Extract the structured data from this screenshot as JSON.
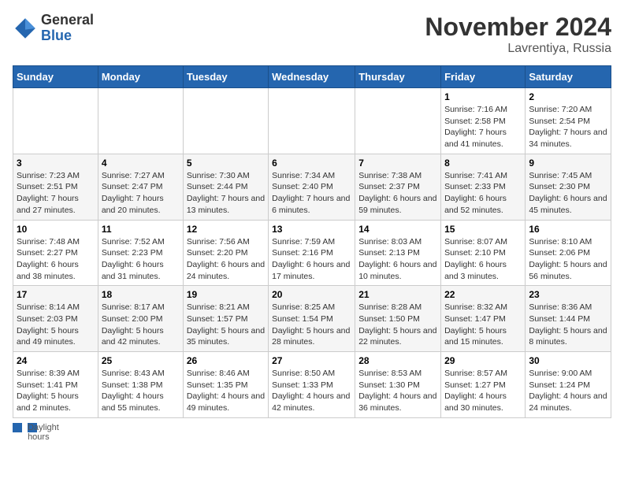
{
  "header": {
    "logo_general": "General",
    "logo_blue": "Blue",
    "month_title": "November 2024",
    "location": "Lavrentiya, Russia"
  },
  "days_of_week": [
    "Sunday",
    "Monday",
    "Tuesday",
    "Wednesday",
    "Thursday",
    "Friday",
    "Saturday"
  ],
  "weeks": [
    [
      {
        "num": "",
        "sunrise": "",
        "sunset": "",
        "daylight": ""
      },
      {
        "num": "",
        "sunrise": "",
        "sunset": "",
        "daylight": ""
      },
      {
        "num": "",
        "sunrise": "",
        "sunset": "",
        "daylight": ""
      },
      {
        "num": "",
        "sunrise": "",
        "sunset": "",
        "daylight": ""
      },
      {
        "num": "",
        "sunrise": "",
        "sunset": "",
        "daylight": ""
      },
      {
        "num": "1",
        "sunrise": "Sunrise: 7:16 AM",
        "sunset": "Sunset: 2:58 PM",
        "daylight": "Daylight: 7 hours and 41 minutes."
      },
      {
        "num": "2",
        "sunrise": "Sunrise: 7:20 AM",
        "sunset": "Sunset: 2:54 PM",
        "daylight": "Daylight: 7 hours and 34 minutes."
      }
    ],
    [
      {
        "num": "3",
        "sunrise": "Sunrise: 7:23 AM",
        "sunset": "Sunset: 2:51 PM",
        "daylight": "Daylight: 7 hours and 27 minutes."
      },
      {
        "num": "4",
        "sunrise": "Sunrise: 7:27 AM",
        "sunset": "Sunset: 2:47 PM",
        "daylight": "Daylight: 7 hours and 20 minutes."
      },
      {
        "num": "5",
        "sunrise": "Sunrise: 7:30 AM",
        "sunset": "Sunset: 2:44 PM",
        "daylight": "Daylight: 7 hours and 13 minutes."
      },
      {
        "num": "6",
        "sunrise": "Sunrise: 7:34 AM",
        "sunset": "Sunset: 2:40 PM",
        "daylight": "Daylight: 7 hours and 6 minutes."
      },
      {
        "num": "7",
        "sunrise": "Sunrise: 7:38 AM",
        "sunset": "Sunset: 2:37 PM",
        "daylight": "Daylight: 6 hours and 59 minutes."
      },
      {
        "num": "8",
        "sunrise": "Sunrise: 7:41 AM",
        "sunset": "Sunset: 2:33 PM",
        "daylight": "Daylight: 6 hours and 52 minutes."
      },
      {
        "num": "9",
        "sunrise": "Sunrise: 7:45 AM",
        "sunset": "Sunset: 2:30 PM",
        "daylight": "Daylight: 6 hours and 45 minutes."
      }
    ],
    [
      {
        "num": "10",
        "sunrise": "Sunrise: 7:48 AM",
        "sunset": "Sunset: 2:27 PM",
        "daylight": "Daylight: 6 hours and 38 minutes."
      },
      {
        "num": "11",
        "sunrise": "Sunrise: 7:52 AM",
        "sunset": "Sunset: 2:23 PM",
        "daylight": "Daylight: 6 hours and 31 minutes."
      },
      {
        "num": "12",
        "sunrise": "Sunrise: 7:56 AM",
        "sunset": "Sunset: 2:20 PM",
        "daylight": "Daylight: 6 hours and 24 minutes."
      },
      {
        "num": "13",
        "sunrise": "Sunrise: 7:59 AM",
        "sunset": "Sunset: 2:16 PM",
        "daylight": "Daylight: 6 hours and 17 minutes."
      },
      {
        "num": "14",
        "sunrise": "Sunrise: 8:03 AM",
        "sunset": "Sunset: 2:13 PM",
        "daylight": "Daylight: 6 hours and 10 minutes."
      },
      {
        "num": "15",
        "sunrise": "Sunrise: 8:07 AM",
        "sunset": "Sunset: 2:10 PM",
        "daylight": "Daylight: 6 hours and 3 minutes."
      },
      {
        "num": "16",
        "sunrise": "Sunrise: 8:10 AM",
        "sunset": "Sunset: 2:06 PM",
        "daylight": "Daylight: 5 hours and 56 minutes."
      }
    ],
    [
      {
        "num": "17",
        "sunrise": "Sunrise: 8:14 AM",
        "sunset": "Sunset: 2:03 PM",
        "daylight": "Daylight: 5 hours and 49 minutes."
      },
      {
        "num": "18",
        "sunrise": "Sunrise: 8:17 AM",
        "sunset": "Sunset: 2:00 PM",
        "daylight": "Daylight: 5 hours and 42 minutes."
      },
      {
        "num": "19",
        "sunrise": "Sunrise: 8:21 AM",
        "sunset": "Sunset: 1:57 PM",
        "daylight": "Daylight: 5 hours and 35 minutes."
      },
      {
        "num": "20",
        "sunrise": "Sunrise: 8:25 AM",
        "sunset": "Sunset: 1:54 PM",
        "daylight": "Daylight: 5 hours and 28 minutes."
      },
      {
        "num": "21",
        "sunrise": "Sunrise: 8:28 AM",
        "sunset": "Sunset: 1:50 PM",
        "daylight": "Daylight: 5 hours and 22 minutes."
      },
      {
        "num": "22",
        "sunrise": "Sunrise: 8:32 AM",
        "sunset": "Sunset: 1:47 PM",
        "daylight": "Daylight: 5 hours and 15 minutes."
      },
      {
        "num": "23",
        "sunrise": "Sunrise: 8:36 AM",
        "sunset": "Sunset: 1:44 PM",
        "daylight": "Daylight: 5 hours and 8 minutes."
      }
    ],
    [
      {
        "num": "24",
        "sunrise": "Sunrise: 8:39 AM",
        "sunset": "Sunset: 1:41 PM",
        "daylight": "Daylight: 5 hours and 2 minutes."
      },
      {
        "num": "25",
        "sunrise": "Sunrise: 8:43 AM",
        "sunset": "Sunset: 1:38 PM",
        "daylight": "Daylight: 4 hours and 55 minutes."
      },
      {
        "num": "26",
        "sunrise": "Sunrise: 8:46 AM",
        "sunset": "Sunset: 1:35 PM",
        "daylight": "Daylight: 4 hours and 49 minutes."
      },
      {
        "num": "27",
        "sunrise": "Sunrise: 8:50 AM",
        "sunset": "Sunset: 1:33 PM",
        "daylight": "Daylight: 4 hours and 42 minutes."
      },
      {
        "num": "28",
        "sunrise": "Sunrise: 8:53 AM",
        "sunset": "Sunset: 1:30 PM",
        "daylight": "Daylight: 4 hours and 36 minutes."
      },
      {
        "num": "29",
        "sunrise": "Sunrise: 8:57 AM",
        "sunset": "Sunset: 1:27 PM",
        "daylight": "Daylight: 4 hours and 30 minutes."
      },
      {
        "num": "30",
        "sunrise": "Sunrise: 9:00 AM",
        "sunset": "Sunset: 1:24 PM",
        "daylight": "Daylight: 4 hours and 24 minutes."
      }
    ]
  ],
  "footer": {
    "note": "Daylight hours"
  }
}
